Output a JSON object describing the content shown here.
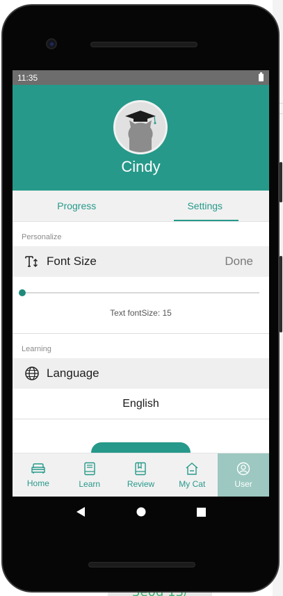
{
  "status_bar": {
    "time": "11:35",
    "battery_icon": "battery-full-icon"
  },
  "profile": {
    "username": "Cindy",
    "avatar_icon": "cat-graduate-avatar-icon"
  },
  "tabs": [
    {
      "label": "Progress",
      "active": false
    },
    {
      "label": "Settings",
      "active": true
    }
  ],
  "sections": {
    "personalize": {
      "label": "Personalize",
      "font_size": {
        "label": "Font Size",
        "icon": "text-size-icon",
        "done_label": "Done"
      },
      "slider": {
        "caption": "Text fontSize: 15",
        "level": 0
      }
    },
    "learning": {
      "label": "Learning",
      "language": {
        "label": "Language",
        "icon": "globe-icon",
        "value": "English"
      }
    }
  },
  "bottom_nav": [
    {
      "label": "Home",
      "icon": "sofa-icon",
      "active": false
    },
    {
      "label": "Learn",
      "icon": "book-icon",
      "active": false
    },
    {
      "label": "Review",
      "icon": "bookmark-book-icon",
      "active": false
    },
    {
      "label": "My Cat",
      "icon": "house-icon",
      "active": false
    },
    {
      "label": "User",
      "icon": "user-icon",
      "active": true
    }
  ],
  "android_nav": {
    "back": "back-triangle-icon",
    "home": "home-circle-icon",
    "recents": "recents-square-icon"
  },
  "colors": {
    "accent": "#26998a",
    "active_nav_bg": "#9cc8c1",
    "status_bar": "#6d6d6d"
  }
}
